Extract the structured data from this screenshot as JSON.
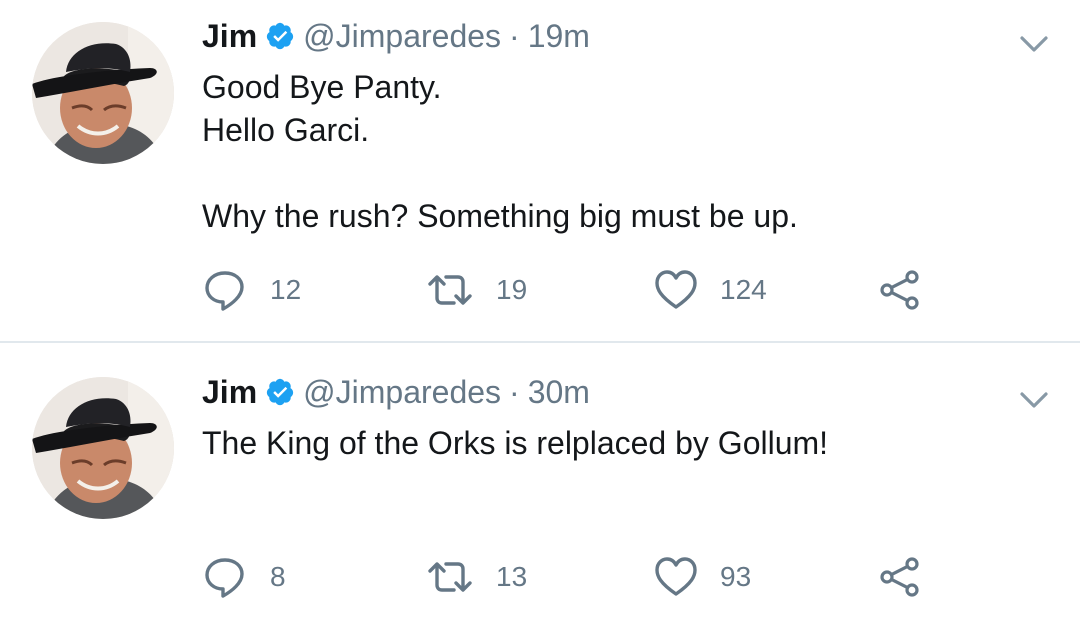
{
  "colors": {
    "text": "#14171a",
    "secondary": "#657786",
    "verified": "#1da1f2",
    "divider": "#e1e8ed",
    "icon": "#657786"
  },
  "tweets": [
    {
      "name": "Jim",
      "handle": "@Jimparedes",
      "separator": "·",
      "time": "19m",
      "lines": [
        "Good Bye Panty.",
        "Hello Garci.",
        "",
        "Why the rush? Something big must be up."
      ],
      "replies": "12",
      "retweets": "19",
      "likes": "124",
      "icons": [
        "verified-badge-icon",
        "chevron-down-icon",
        "reply-icon",
        "retweet-icon",
        "heart-icon",
        "share-icon"
      ]
    },
    {
      "name": "Jim",
      "handle": "@Jimparedes",
      "separator": "·",
      "time": "30m",
      "lines": [
        "The King of the Orks is relplaced by Gollum!"
      ],
      "replies": "8",
      "retweets": "13",
      "likes": "93",
      "icons": [
        "verified-badge-icon",
        "chevron-down-icon",
        "reply-icon",
        "retweet-icon",
        "heart-icon",
        "share-icon"
      ]
    }
  ]
}
